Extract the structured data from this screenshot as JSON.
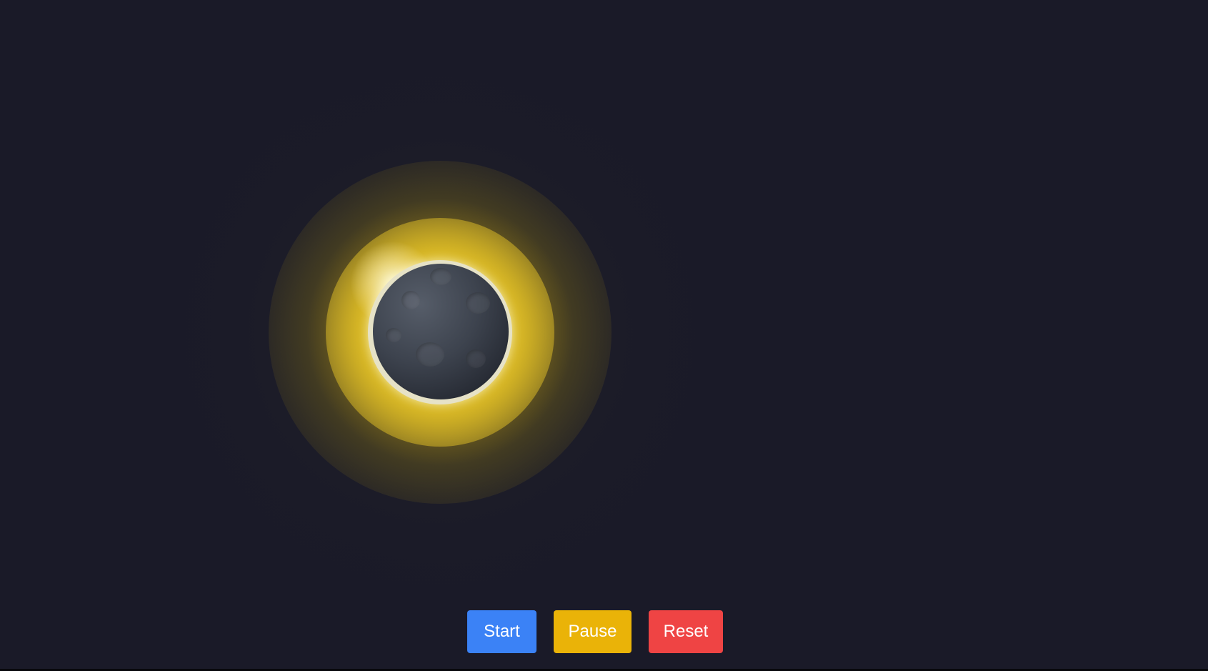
{
  "scene": {
    "background_color": "#1a1a28",
    "corona_color": "#eab308",
    "ring_color": "#e6e2c7",
    "moon_color": "#3d434e"
  },
  "controls": {
    "start_label": "Start",
    "pause_label": "Pause",
    "reset_label": "Reset",
    "start_color": "#3b82f6",
    "pause_color": "#eab308",
    "reset_color": "#ef4444"
  }
}
